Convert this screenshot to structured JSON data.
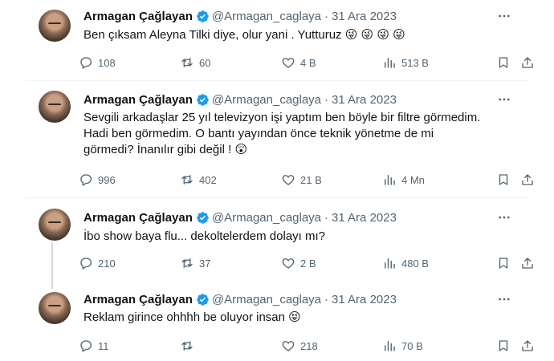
{
  "tweets": [
    {
      "name": "Armagan Çağlayan",
      "handle": "@Armagan_caglaya",
      "dot": "·",
      "date": "31 Ara 2023",
      "text": "Ben çıksam Aleyna Tilki diye, olur yani . Yutturuz",
      "emoji": "😜 😜 😜 😜",
      "replies": "108",
      "retweets": "60",
      "likes": "4 B",
      "views": "513 B"
    },
    {
      "name": "Armagan Çağlayan",
      "handle": "@Armagan_caglaya",
      "dot": "·",
      "date": "31 Ara 2023",
      "text": "Sevgili arkadaşlar 25 yıl televizyon işi yaptım ben böyle bir filtre görmedim.\nHadi ben görmedim. O bantı yayından önce teknik yönetme de mi\ngörmedi? İnanılır gibi değil !",
      "emoji": "😲",
      "replies": "996",
      "retweets": "402",
      "likes": "21 B",
      "views": "4 Mn"
    },
    {
      "name": "Armagan Çağlayan",
      "handle": "@Armagan_caglaya",
      "dot": "·",
      "date": "31 Ara 2023",
      "text": "İbo show baya flu... dekoltelerdem dolayı mı?",
      "emoji": "",
      "replies": "210",
      "retweets": "37",
      "likes": "2 B",
      "views": "480 B"
    },
    {
      "name": "Armagan Çağlayan",
      "handle": "@Armagan_caglaya",
      "dot": "·",
      "date": "31 Ara 2023",
      "text": "Reklam girince ohhhh be oluyor insan",
      "emoji": "😝",
      "replies": "11",
      "retweets": "",
      "likes": "218",
      "views": "70 B"
    }
  ],
  "colors": {
    "text": "#0f1419",
    "muted": "#536471",
    "verified": "#1d9bf0",
    "divider": "#eff3f4",
    "thread": "#cfd9de"
  }
}
